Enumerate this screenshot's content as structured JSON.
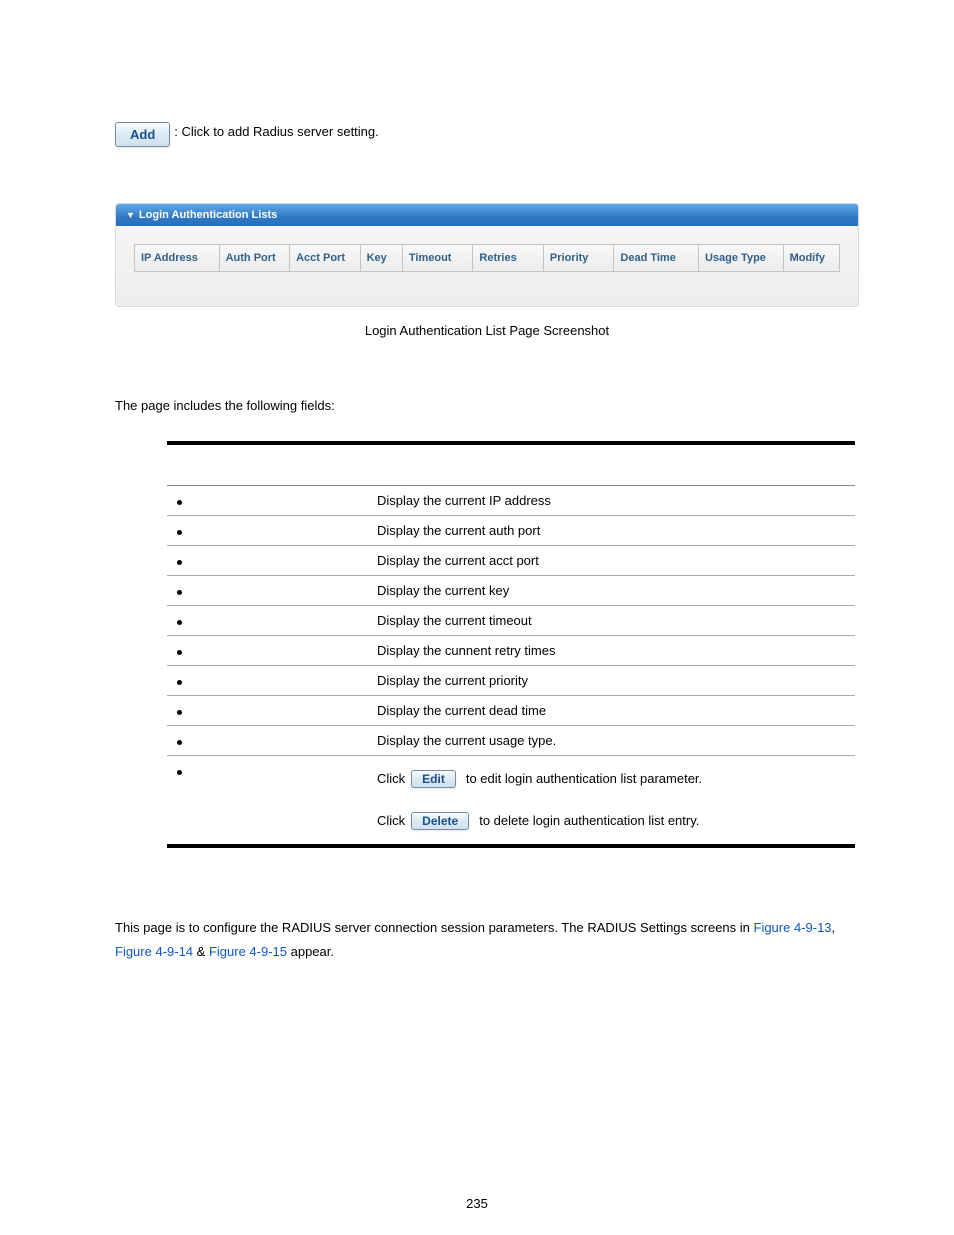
{
  "add": {
    "button": "Add",
    "desc": ": Click to add Radius server setting."
  },
  "panel": {
    "title": "Login Authentication Lists",
    "headers": [
      "IP Address",
      "Auth Port",
      "Acct Port",
      "Key",
      "Timeout",
      "Retries",
      "Priority",
      "Dead Time",
      "Usage Type",
      "Modify"
    ]
  },
  "caption": "Login Authentication List Page Screenshot",
  "fields_intro": "The page includes the following fields:",
  "rows": [
    {
      "desc": "Display the current IP address"
    },
    {
      "desc": "Display the current auth port"
    },
    {
      "desc": "Display the current acct port"
    },
    {
      "desc": "Display the current key"
    },
    {
      "desc": "Display the current timeout"
    },
    {
      "desc": "Display the cunnent retry times"
    },
    {
      "desc": "Display the current priority"
    },
    {
      "desc": "Display the current dead time"
    },
    {
      "desc": "Display the current usage type."
    }
  ],
  "modify": {
    "click": "Click",
    "edit_btn": "Edit",
    "edit_txt": " to edit login authentication list parameter.",
    "delete_btn": "Delete",
    "delete_txt": " to delete login authentication list entry."
  },
  "next": {
    "pre": "This page is to configure the RADIUS server connection session parameters. The RADIUS Settings screens in ",
    "link1": "Figure 4-9-13",
    "sep1": ", ",
    "link2": "Figure 4-9-14",
    "sep2": " & ",
    "link3": "Figure 4-9-15",
    "post": " appear."
  },
  "page_num": "235"
}
